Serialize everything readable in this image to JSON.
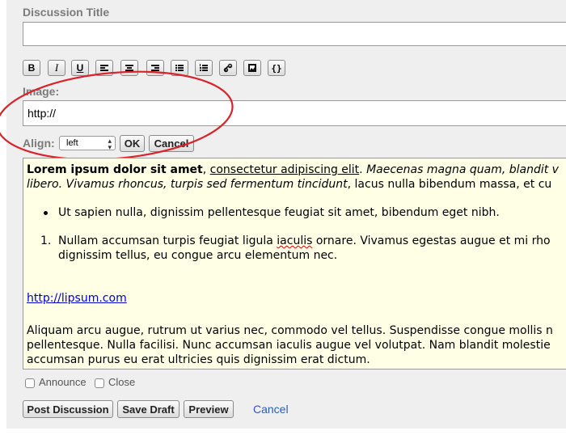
{
  "form": {
    "title_label": "Discussion Title",
    "title_value": "",
    "image_label": "Image:",
    "image_value": "http://",
    "align_label": "Align:",
    "align_value": "left",
    "ok_label": "OK",
    "cancel_label": "Cancel"
  },
  "toolbar": {
    "bold": "B",
    "italic": "I",
    "underline": "U",
    "code": "{}"
  },
  "editor": {
    "p1_bold": "Lorem ipsum dolor sit amet",
    "p1_comma": ", ",
    "p1_underline": "consectetur adipiscing elit",
    "p1_dot": ". ",
    "p1_italic": "Maecenas magna quam, blandit v",
    "p1_l2_italic": "libero. Vivamus rhoncus, turpis sed fermentum tincidunt",
    "p1_l2_rest": ", lacus nulla bibendum massa, et cu",
    "bullet_item": "Ut sapien nulla, dignissim pellentesque feugiat sit amet, bibendum eget nibh.",
    "ol_number": "1.",
    "ol_l1_a": "Nullam accumsan turpis feugiat ligula ",
    "ol_l1_b": "iaculis",
    "ol_l1_c": " ornare. Vivamus egestas augue et mi rho",
    "ol_l2": "dignissim tellus, eu congue arcu elementum nec.",
    "link": "http://lipsum.com",
    "p3_l1": "Aliquam arcu augue, rutrum ut varius nec, commodo vel tellus. Suspendisse congue mollis n",
    "p3_l2": "pellentesque. Nulla facilisi. Nunc accumsan iaculis augue vel volutpat. Nam blandit molestie",
    "p3_l3": "accumsan purus eu erat ultricies quis dignissim erat dictum."
  },
  "options": {
    "announce": "Announce",
    "close": "Close"
  },
  "actions": {
    "post": "Post Discussion",
    "save": "Save Draft",
    "preview": "Preview",
    "cancel": "Cancel"
  },
  "colors": {
    "panel_bg": "#efefef",
    "editor_bg": "#ffffe6",
    "annotation": "#d9222a",
    "link": "#0000cc"
  }
}
